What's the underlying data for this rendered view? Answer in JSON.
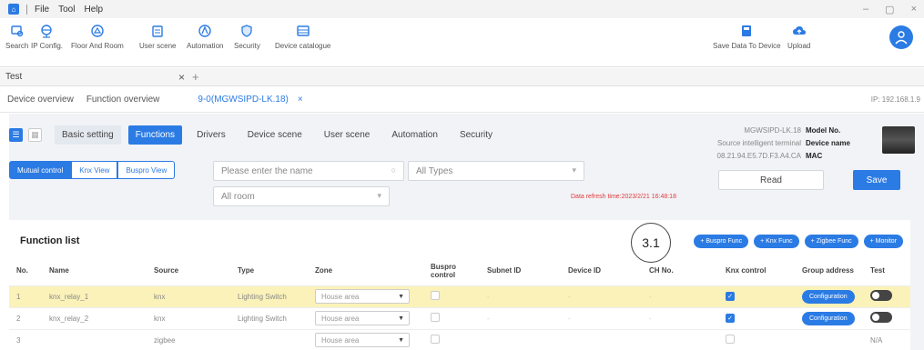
{
  "app": {
    "menu": [
      "File",
      "Tool",
      "Help"
    ],
    "window_controls": [
      "–",
      "▢",
      "×"
    ]
  },
  "toolbar": {
    "search": "Search",
    "ip_config": "IP Config.",
    "floor_room": "Floor And Room",
    "user_scene": "User scene",
    "automation": "Automation",
    "security": "Security",
    "device_catalogue": "Device catalogue",
    "save_to_device": "Save Data To Device",
    "upload": "Upload"
  },
  "project": {
    "name": "Test",
    "close": "×",
    "add": "+"
  },
  "tabs": {
    "device_overview": "Device overview",
    "function_overview": "Function overview",
    "active_tab": "9-0(MGWSIPD-LK.18)",
    "active_close": "×",
    "ip": "IP: 192.168.1.9"
  },
  "subtabs": [
    "Basic setting",
    "Functions",
    "Drivers",
    "Device scene",
    "User scene",
    "Automation",
    "Security"
  ],
  "views": [
    "Mutual control",
    "Knx View",
    "Buspro View"
  ],
  "filters": {
    "name_placeholder": "Please enter the name",
    "types": "All Types",
    "room": "All room"
  },
  "device": {
    "model_value": "MGWSIPD-LK.18",
    "model_label": "Model No.",
    "name_value": "Source intelligent terminal",
    "name_label": "Device name",
    "mac_value": "08.21.94.E5.7D.F3.A4.CA",
    "mac_label": "MAC"
  },
  "buttons": {
    "read": "Read",
    "save": "Save"
  },
  "refresh_text": "Data refresh time:2023/2/21 16:48:18",
  "function_list": {
    "title": "Function list",
    "badge": "3.1",
    "actions": [
      "+ Buspro Func",
      "+ Knx Func",
      "+ Zigbee Func",
      "+ Monitor"
    ],
    "columns": [
      "No.",
      "Name",
      "Source",
      "Type",
      "Zone",
      "Buspro control",
      "Subnet ID",
      "Device ID",
      "CH No.",
      "Knx control",
      "Group address",
      "Test"
    ],
    "rows": [
      {
        "no": "1",
        "name": "knx_relay_1",
        "source": "knx",
        "type": "Lighting Switch",
        "zone": "House area",
        "subnet": "-",
        "device": "-",
        "ch": "-",
        "group": "Configuration"
      },
      {
        "no": "2",
        "name": "knx_relay_2",
        "source": "knx",
        "type": "Lighting Switch",
        "zone": "House area",
        "subnet": "-",
        "device": "-",
        "ch": "-",
        "group": "Configuration"
      },
      {
        "no": "3",
        "name": "",
        "source": "zigbee",
        "type": "",
        "zone": "House area",
        "subnet": "",
        "device": "",
        "ch": "",
        "group": "N/A"
      }
    ]
  },
  "colors": {
    "accent": "#2b7be4",
    "highlight_row": "#fbf2b9",
    "refresh_red": "#e23a3a"
  }
}
